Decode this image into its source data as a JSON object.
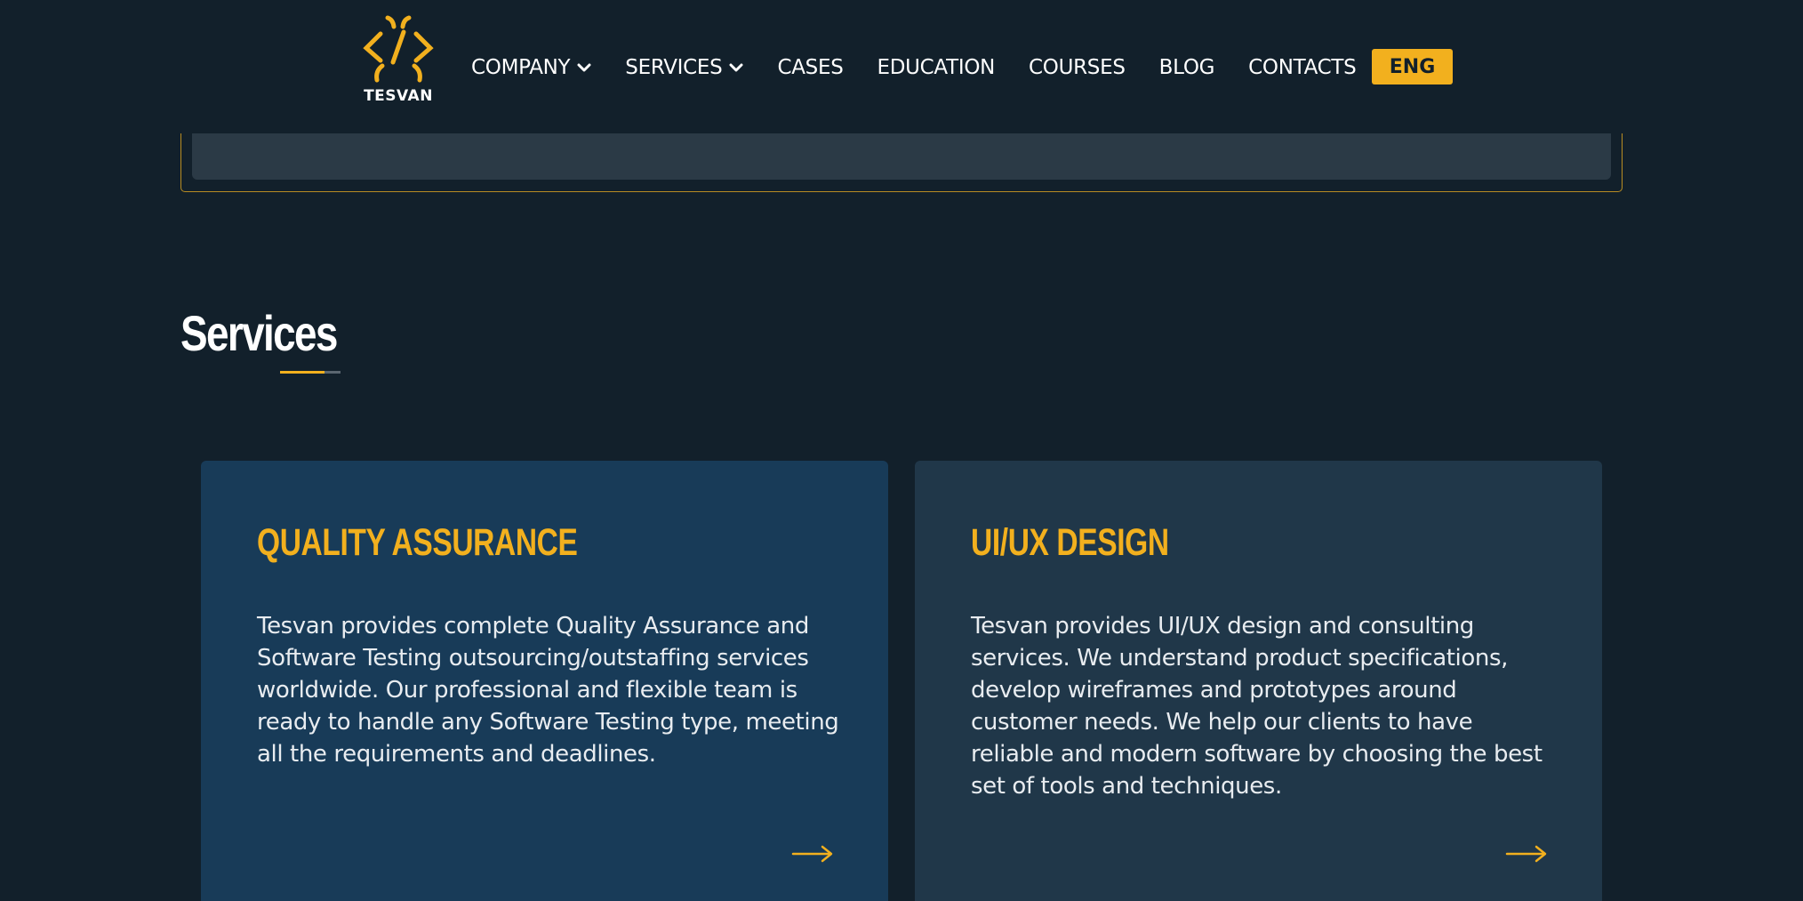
{
  "logo": {
    "text": "TESVAN",
    "icon": "code-brackets-bug-icon"
  },
  "nav": {
    "items": [
      {
        "label": "COMPANY",
        "has_dropdown": true
      },
      {
        "label": "SERVICES",
        "has_dropdown": true
      },
      {
        "label": "CASES",
        "has_dropdown": false
      },
      {
        "label": "EDUCATION",
        "has_dropdown": false
      },
      {
        "label": "COURSES",
        "has_dropdown": false
      },
      {
        "label": "BLOG",
        "has_dropdown": false
      },
      {
        "label": "CONTACTS",
        "has_dropdown": false
      }
    ],
    "lang": "ENG"
  },
  "section": {
    "title": "Services"
  },
  "cards": [
    {
      "title": "QUALITY ASSURANCE",
      "text": "Tesvan provides complete Quality Assurance and Software Testing outsourcing/outstaffing services worldwide. Our professional and flexible team is ready to handle any Software Testing type, meeting all the requirements and deadlines.",
      "icon": "arrow-right-icon"
    },
    {
      "title": "UI/UX DESIGN",
      "text": "Tesvan provides UI/UX design and consulting services. We understand product specifications, develop wireframes and prototypes around customer needs. We help our clients to have reliable and modern software by choosing the best set of tools and techniques.",
      "icon": "arrow-right-icon"
    }
  ],
  "colors": {
    "background": "#12202b",
    "accent": "#f2b01e",
    "card_qa": "#183b58",
    "card_ux": "#203749"
  }
}
